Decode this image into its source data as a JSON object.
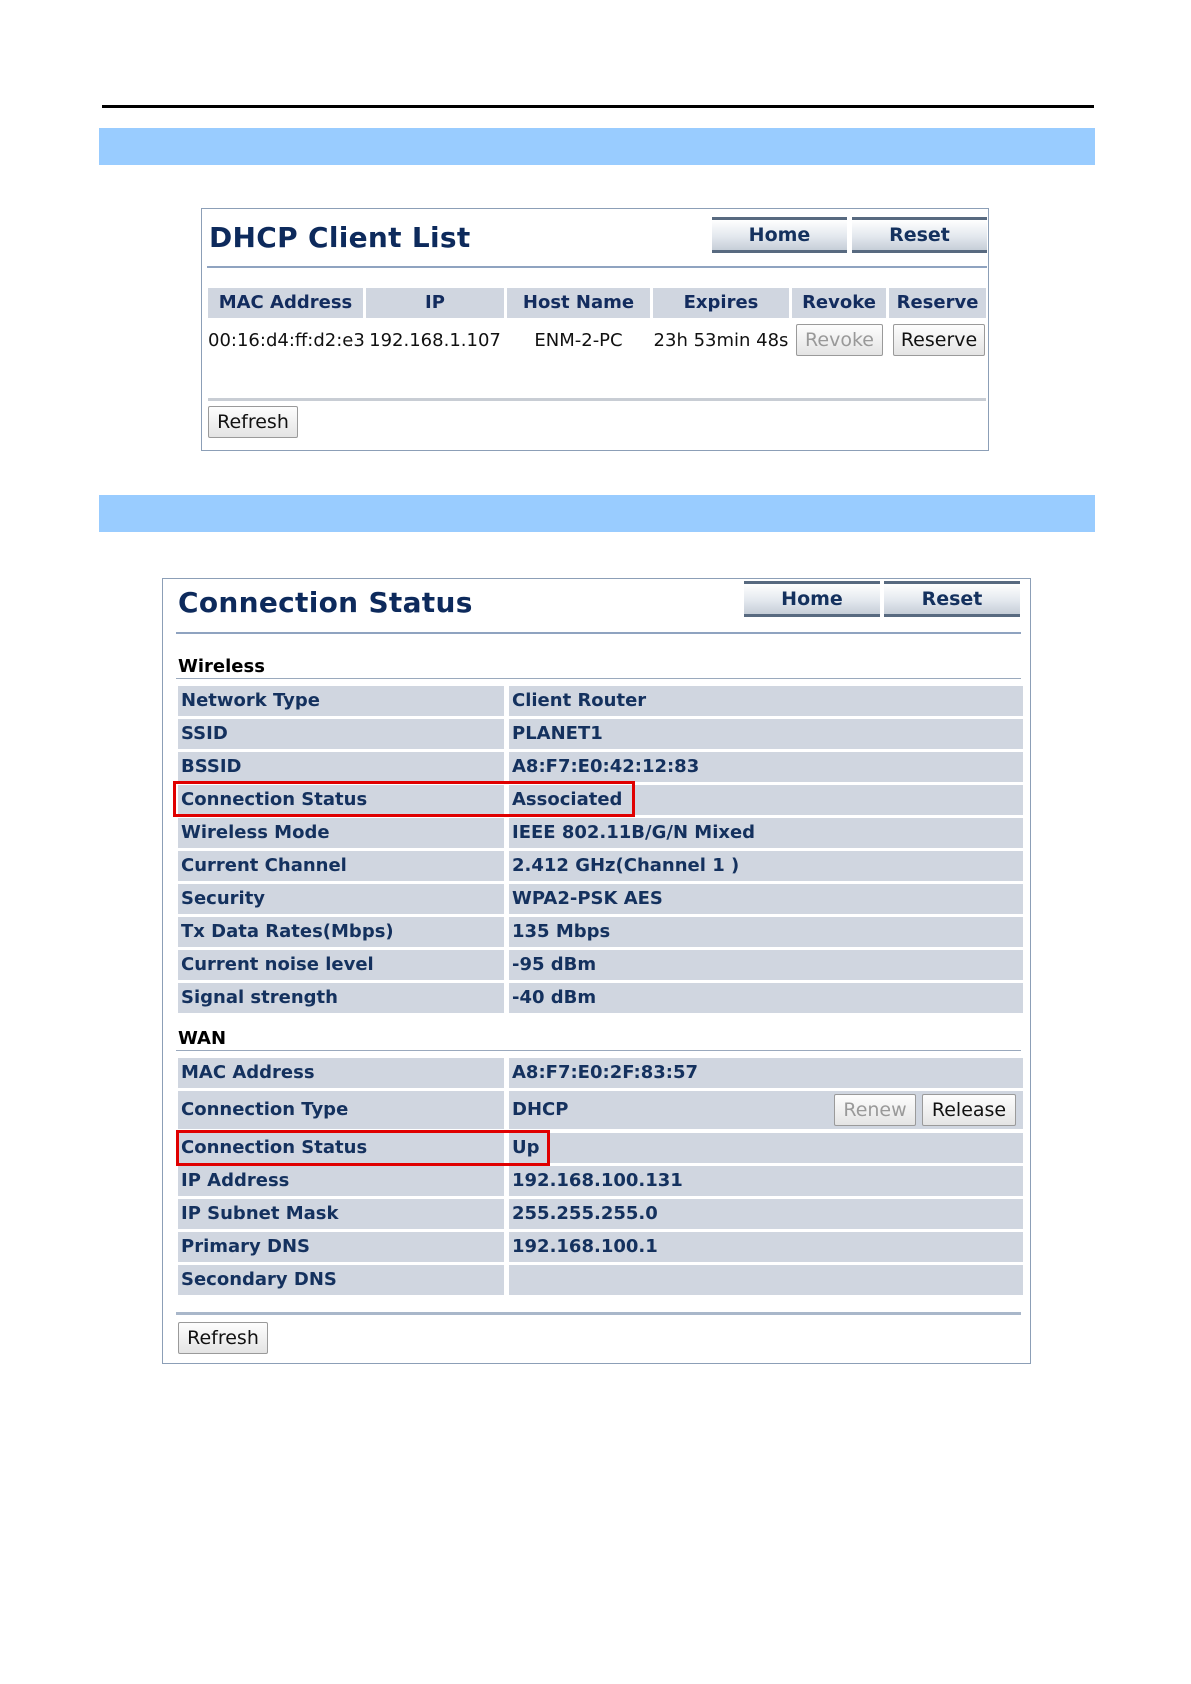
{
  "dhcp": {
    "title": "DHCP Client List",
    "home_label": "Home",
    "reset_label": "Reset",
    "columns": [
      "MAC Address",
      "IP",
      "Host Name",
      "Expires",
      "Revoke",
      "Reserve"
    ],
    "rows": [
      {
        "mac": "00:16:d4:ff:d2:e3",
        "ip": "192.168.1.107",
        "host": "ENM-2-PC",
        "expires": "23h 53min 48s",
        "revoke_label": "Revoke",
        "reserve_label": "Reserve"
      }
    ],
    "refresh_label": "Refresh"
  },
  "status": {
    "title": "Connection Status",
    "home_label": "Home",
    "reset_label": "Reset",
    "wireless": {
      "heading": "Wireless",
      "rows": [
        {
          "label": "Network Type",
          "value": "Client Router"
        },
        {
          "label": "SSID",
          "value": "PLANET1"
        },
        {
          "label": "BSSID",
          "value": "A8:F7:E0:42:12:83"
        },
        {
          "label": "Connection Status",
          "value": "Associated"
        },
        {
          "label": "Wireless Mode",
          "value": "IEEE 802.11B/G/N Mixed"
        },
        {
          "label": "Current Channel",
          "value": "2.412 GHz(Channel 1 )"
        },
        {
          "label": "Security",
          "value": "WPA2-PSK AES"
        },
        {
          "label": "Tx Data Rates(Mbps)",
          "value": "135 Mbps"
        },
        {
          "label": "Current noise level",
          "value": "-95 dBm"
        },
        {
          "label": "Signal strength",
          "value": "-40 dBm"
        }
      ]
    },
    "wan": {
      "heading": "WAN",
      "rows": [
        {
          "label": "MAC Address",
          "value": "A8:F7:E0:2F:83:57"
        },
        {
          "label": "Connection Type",
          "value": "DHCP"
        },
        {
          "label": "Connection Status",
          "value": "Up"
        },
        {
          "label": "IP Address",
          "value": "192.168.100.131"
        },
        {
          "label": "IP Subnet Mask",
          "value": "255.255.255.0"
        },
        {
          "label": "Primary DNS",
          "value": "192.168.100.1"
        },
        {
          "label": "Secondary DNS",
          "value": ""
        }
      ],
      "renew_label": "Renew",
      "release_label": "Release"
    },
    "refresh_label": "Refresh"
  },
  "colors": {
    "band": "#99ccff",
    "highlight": "#e00000",
    "title_text": "#0d2a5c",
    "row_bg": "#d0d6e0"
  }
}
